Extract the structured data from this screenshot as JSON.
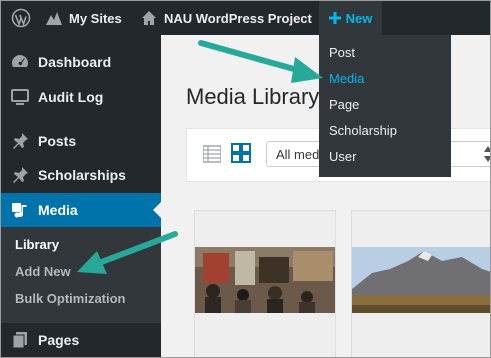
{
  "admin_bar": {
    "my_sites": "My Sites",
    "site_name": "NAU WordPress Project",
    "new_label": "New"
  },
  "new_menu": {
    "items": [
      "Post",
      "Media",
      "Page",
      "Scholarship",
      "User"
    ],
    "highlighted": "Media"
  },
  "sidebar": {
    "items": [
      {
        "label": "Dashboard",
        "icon": "dashboard-icon"
      },
      {
        "label": "Audit Log",
        "icon": "monitor-icon"
      },
      {
        "label": "Posts",
        "icon": "pin-icon"
      },
      {
        "label": "Scholarships",
        "icon": "pin-icon"
      },
      {
        "label": "Media",
        "icon": "media-icon",
        "active": true
      },
      {
        "label": "Pages",
        "icon": "page-icon"
      }
    ],
    "media_submenu": [
      "Library",
      "Add New",
      "Bulk Optimization"
    ]
  },
  "main": {
    "title": "Media Library",
    "filter_select": "All media items"
  },
  "colors": {
    "admin_dark": "#23282d",
    "submenu_bg": "#32373c",
    "accent_blue": "#0073aa",
    "link_blue": "#00b9eb",
    "annotation_arrow": "#27a99a"
  }
}
